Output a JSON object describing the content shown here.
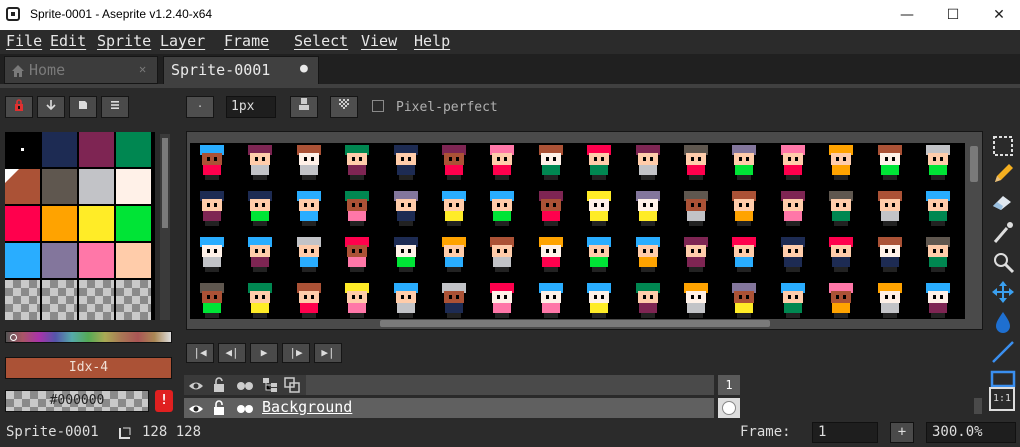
{
  "window": {
    "title": "Sprite-0001 - Aseprite v1.2.40-x64",
    "minimize": "—",
    "maximize": "☐",
    "close": "✕"
  },
  "menu": [
    "File",
    "Edit",
    "Sprite",
    "Layer",
    "Frame",
    "Select",
    "View",
    "Help"
  ],
  "tabs": [
    {
      "label": "Home",
      "close": "✕"
    },
    {
      "label": "Sprite-0001",
      "modified": "●"
    }
  ],
  "context_bar": {
    "brush_size": "1px",
    "pixel_perfect_label": "Pixel-perfect",
    "pixel_perfect_checked": false
  },
  "palette_toolbar": [
    "lock-icon",
    "arrow-down-icon",
    "save-icon",
    "menu-icon"
  ],
  "palette": {
    "colors": [
      "#000000",
      "#1d2b53",
      "#7e2553",
      "#008751",
      "#ab5236",
      "#5f574f",
      "#c2c3c7",
      "#fff1e8",
      "#ff004d",
      "#ffa300",
      "#ffec27",
      "#00e436",
      "#29adff",
      "#83769c",
      "#ff77a8",
      "#ffccaa"
    ],
    "transparent_rows": 1
  },
  "color_bar": {
    "fg_label": "Idx-4",
    "fg_color": "#ab5236",
    "bg_label": "#000000",
    "warning": "!"
  },
  "playback": [
    "first-frame-icon",
    "prev-frame-icon",
    "play-icon",
    "next-frame-icon",
    "last-frame-icon"
  ],
  "timeline": {
    "frame_number": "1",
    "layers": [
      {
        "name": "Background",
        "visible": true,
        "locked": false
      }
    ]
  },
  "status": {
    "sprite_name": "Sprite-0001",
    "size": "128 128",
    "frame_label": "Frame:",
    "frame_value": "1",
    "add_frame": "+",
    "zoom": "300.0%"
  },
  "tools": [
    "rectangular-marquee-icon",
    "pencil-icon",
    "eraser-icon",
    "eyedropper-icon",
    "zoom-icon",
    "move-icon",
    "paint-bucket-icon",
    "line-icon",
    "rectangle-icon"
  ],
  "zoom_button": "1:1",
  "colors": {
    "accent": "#ab5236",
    "background": "#2a2a2a",
    "canvas": "#000000"
  }
}
